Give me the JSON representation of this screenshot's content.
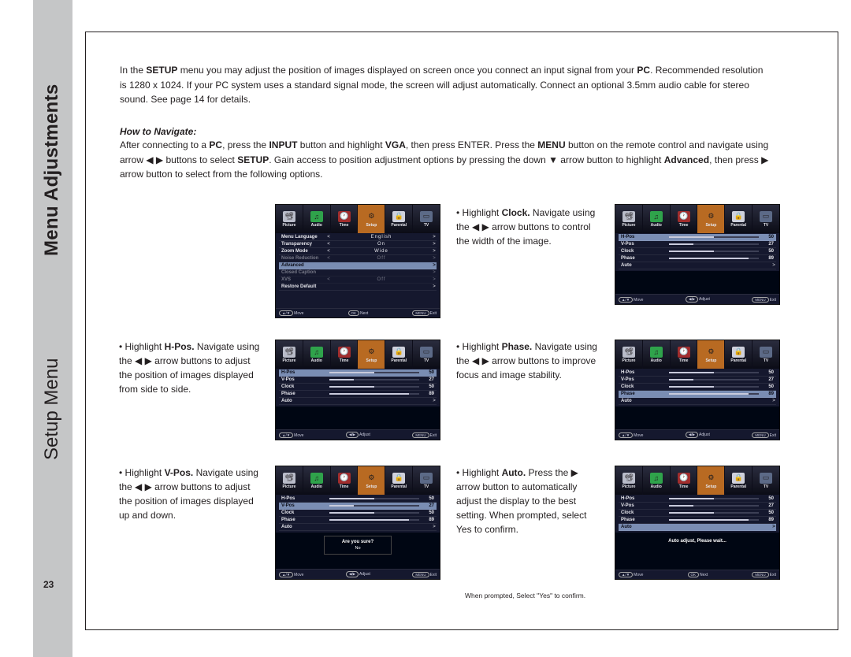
{
  "sidebar": {
    "title_bold": "Menu Adjustments",
    "title_light": "Setup Menu",
    "page_number": "23"
  },
  "intro": {
    "p1a": "In the ",
    "p1b": "SETUP",
    "p1c": " menu you may adjust the position of images displayed on screen once you connect an input signal from your ",
    "p1d": "PC",
    "p1e": ". Recommended resolution is 1280 x 1024. If your PC system uses a standard signal mode, the screen will adjust automatically. Connect an optional 3.5mm audio cable for stereo sound. See page 14 for details."
  },
  "nav": {
    "heading": "How to Navigate:",
    "b1a": "After connecting to a ",
    "b1b": "PC",
    "b1c": ", press the ",
    "b1d": "INPUT",
    "b1e": " button and highlight ",
    "b1f": "VGA",
    "b1g": ", then press ENTER. Press the ",
    "b1h": "MENU",
    "b1i": " button on the remote control and navigate using arrow ◀ ▶ buttons to select ",
    "b1j": "SETUP",
    "b1k": ". Gain access to position adjustment options by pressing the down ▼ arrow button to highlight ",
    "b1l": "Advanced",
    "b1m": ", then press  ▶ arrow button to select from the following options."
  },
  "tabs": [
    {
      "label": "Picture",
      "glyph": "📽",
      "bg": "#b9bcc9"
    },
    {
      "label": "Audio",
      "glyph": "♫",
      "bg": "#2fa34b"
    },
    {
      "label": "Time",
      "glyph": "🕐",
      "bg": "#a12d2d"
    },
    {
      "label": "Setup",
      "glyph": "⚙",
      "bg": "#b86a22"
    },
    {
      "label": "Parental",
      "glyph": "🔒",
      "bg": "#cfd1dc"
    },
    {
      "label": "TV",
      "glyph": "▭",
      "bg": "#5c6a87"
    }
  ],
  "hints": {
    "move": "Move",
    "next": "Next",
    "adjust": "Adjust",
    "exit": "Exit",
    "p_updown": "▲/▼",
    "p_ok": "OK",
    "p_lr": "◀/▶",
    "p_menu": "MENU"
  },
  "osd1_rows": [
    {
      "name": "Menu Language",
      "value": "English"
    },
    {
      "name": "Transparency",
      "value": "On"
    },
    {
      "name": "Zoom Mode",
      "value": "Wide"
    },
    {
      "name": "Noise Reduction",
      "value": "Off",
      "dim": true
    },
    {
      "name": "Advanced",
      "sel": true
    },
    {
      "name": "Closed Caption",
      "dim": true
    },
    {
      "name": "XVS",
      "value": "Off",
      "dim": true
    },
    {
      "name": "Restore Default"
    }
  ],
  "slider_rows": [
    {
      "name": "H-Pos",
      "value": 50
    },
    {
      "name": "V-Pos",
      "value": 27
    },
    {
      "name": "Clock",
      "value": 50
    },
    {
      "name": "Phase",
      "value": 89
    },
    {
      "name": "Auto",
      "auto": true
    }
  ],
  "selected": {
    "osd2": "H-Pos",
    "osd3": "H-Pos",
    "osd4": "Clock",
    "osd5": "V-Pos",
    "osd6": "Phase",
    "osd7": "Auto"
  },
  "caps": {
    "clock": "• Highlight Clock. Navigate using the ◀ ▶ arrow buttons to control the width of the image.",
    "hpos": "• Highlight H-Pos. Navigate using the ◀ ▶ arrow buttons to adjust the position of images displayed from side to side.",
    "phase": "• Highlight Phase. Navigate using the ◀ ▶ arrow buttons to improve focus and image stability.",
    "vpos": "• Highlight V-Pos. Navigate using the ◀ ▶ arrow buttons to adjust the position of images displayed up and down.",
    "auto": "• Highlight Auto. Press the ▶ arrow button to automatically adjust the display to the best setting. When prompted, select Yes to confirm."
  },
  "caps_bold": {
    "clock": "Clock.",
    "hpos": "H-Pos.",
    "phase": "Phase.",
    "vpos": "V-Pos.",
    "auto": "Auto."
  },
  "caps_pre": "• Highlight ",
  "caps_post": {
    "clock": " Navigate using the ◀ ▶ arrow buttons to control the width of the image.",
    "hpos": " Navigate using the ◀ ▶ arrow buttons to adjust the position of images displayed from side to side.",
    "phase": " Navigate using the ◀ ▶ arrow buttons to improve focus and image stability.",
    "vpos": " Navigate using the ◀ ▶ arrow buttons to adjust the position of images displayed up and down.",
    "auto": " Press the ▶ arrow button to automatically adjust the display to the best setting. When prompted, select Yes to confirm."
  },
  "confirm_prompt": {
    "title": "Are you sure?",
    "no": "No"
  },
  "auto_msg": "Auto adjust, Please wait...",
  "confirm_note": "When prompted, Select \"Yes\" to confirm."
}
